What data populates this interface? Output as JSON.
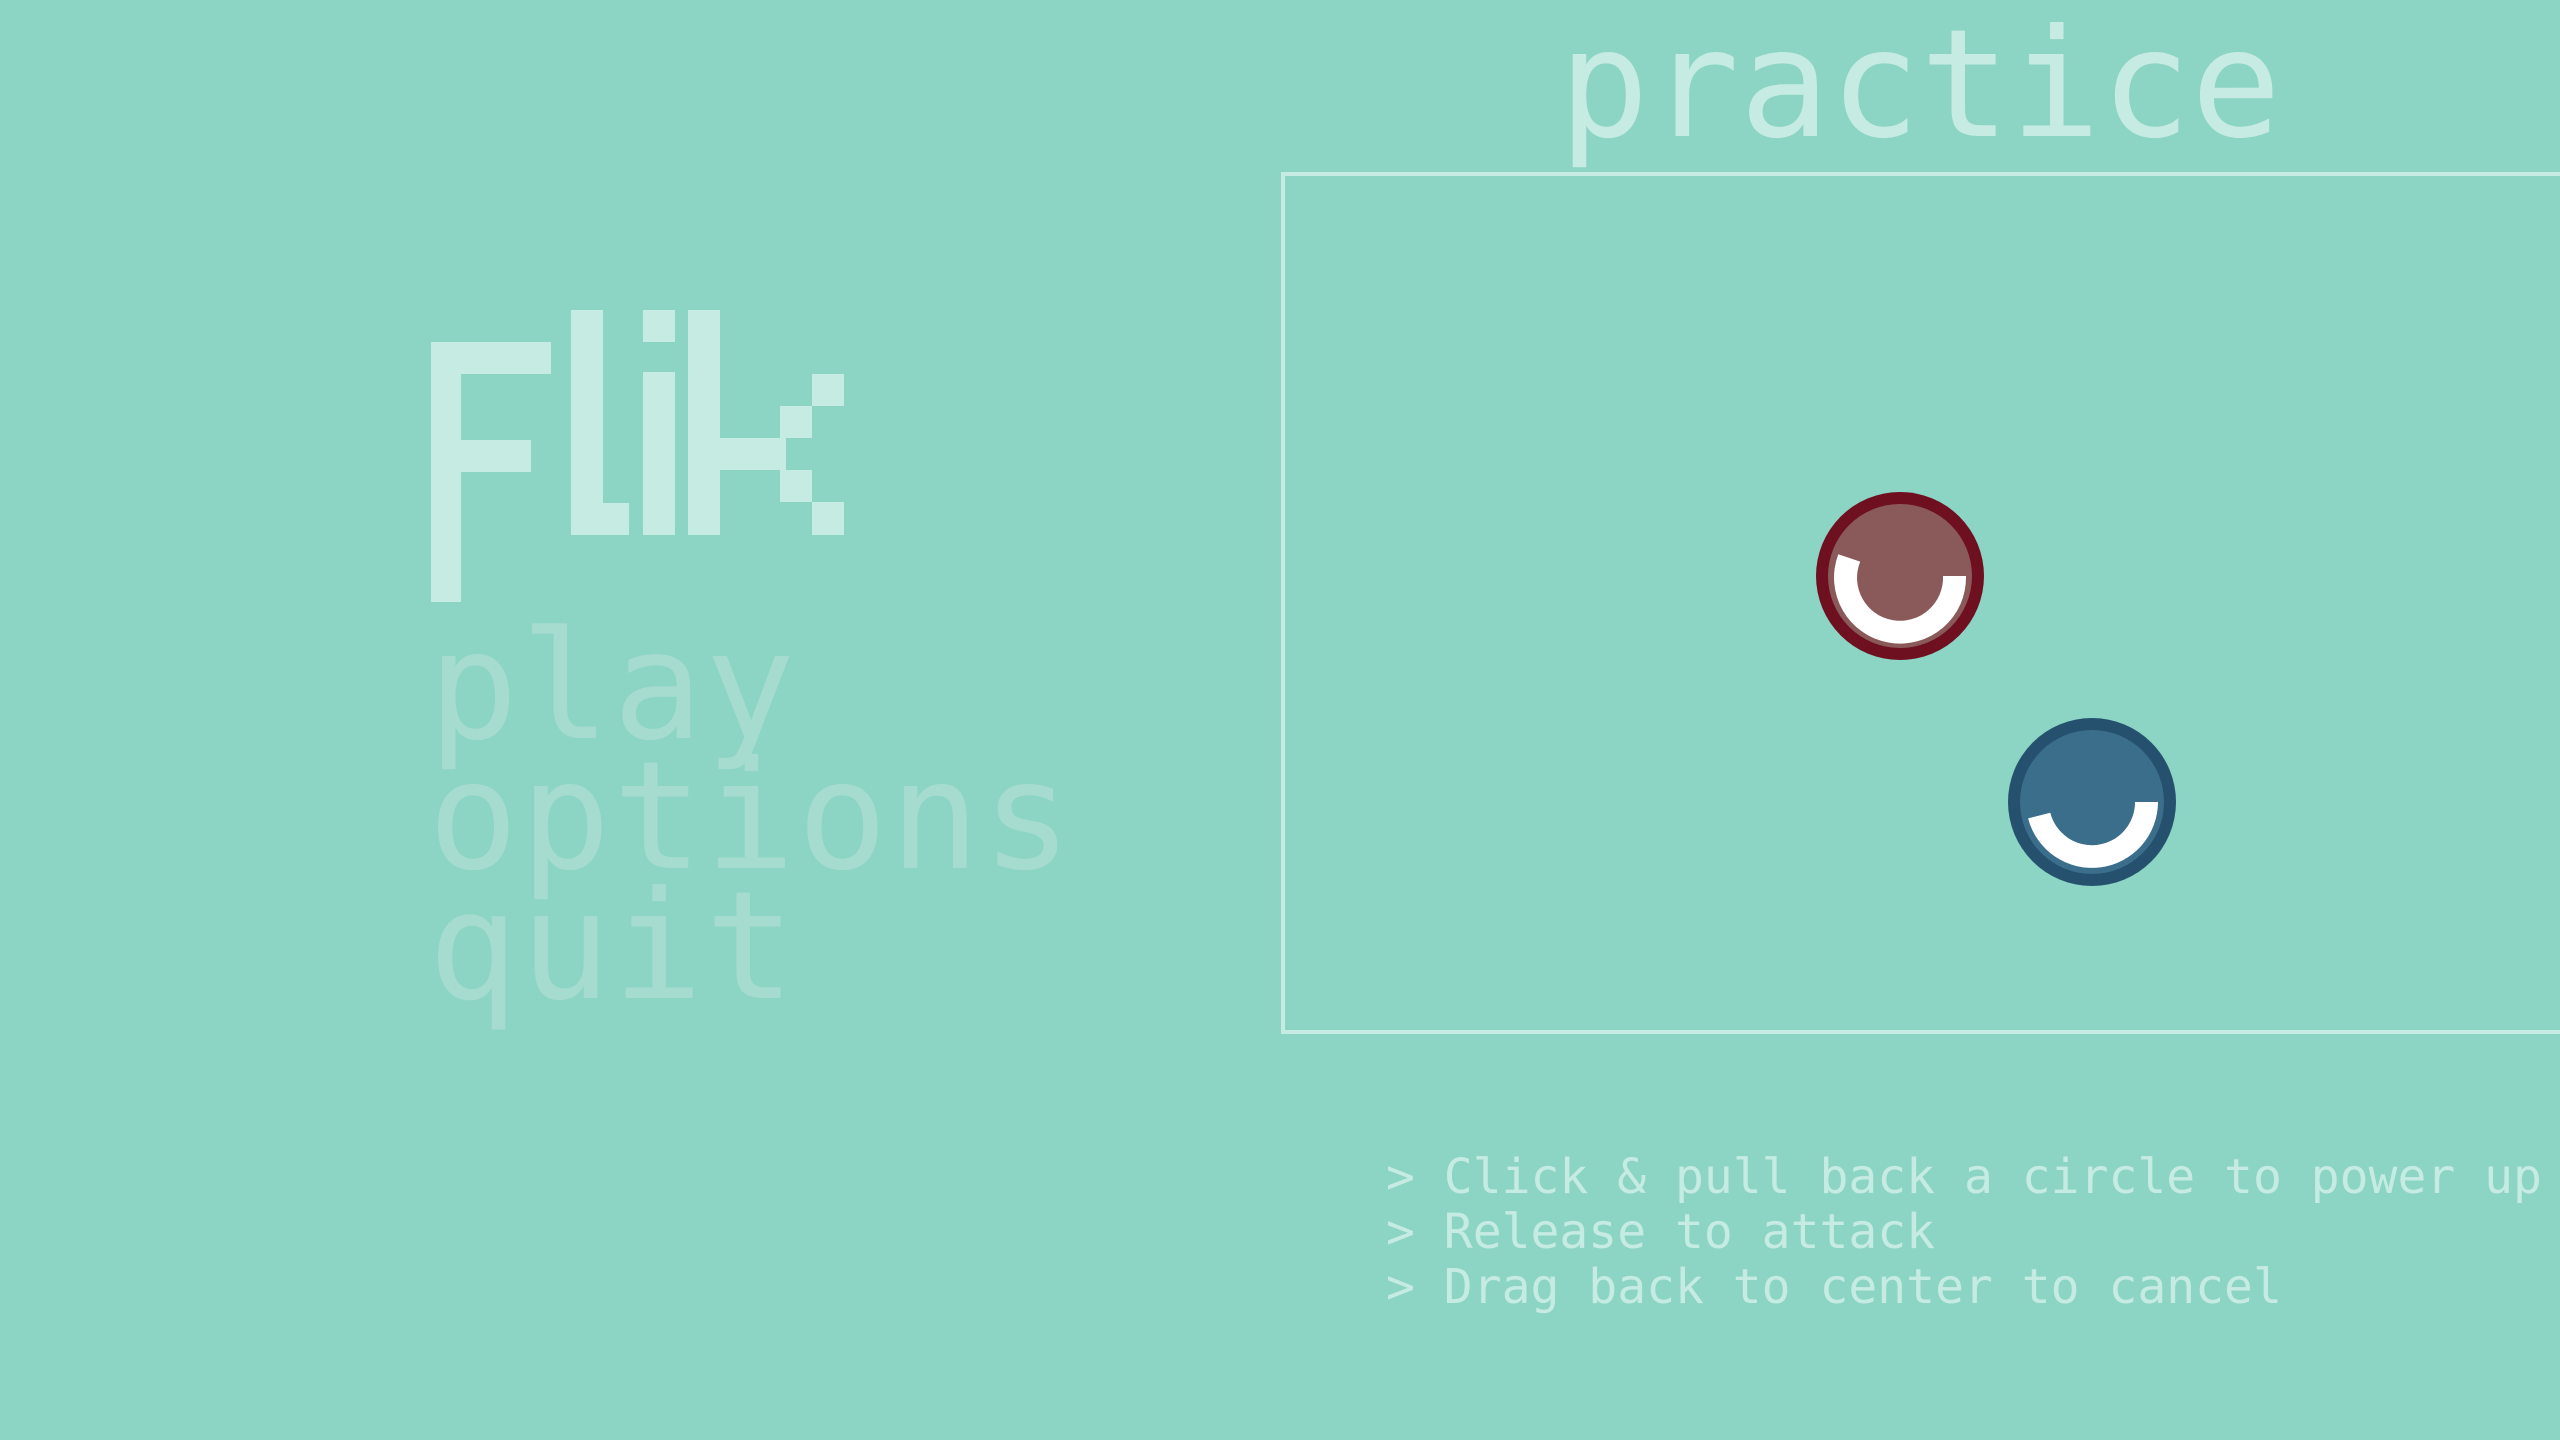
{
  "game": {
    "title": "Flik",
    "mode_title": "practice"
  },
  "menu": {
    "items": [
      {
        "label": "play"
      },
      {
        "label": "options"
      },
      {
        "label": "quit"
      }
    ]
  },
  "instructions": [
    "> Click & pull back a circle to power up",
    "> Release to attack",
    "> Drag back to center to cancel"
  ],
  "colors": {
    "background": "#8cd4c4",
    "light_text": "#c6ebe2",
    "menu_text": "#a6dccf",
    "red_ring": "#6e1020",
    "red_fill": "#8a5a5a",
    "blue_ring": "#25516e",
    "blue_fill": "#3a6e8a",
    "power_arc": "#ffffff"
  }
}
